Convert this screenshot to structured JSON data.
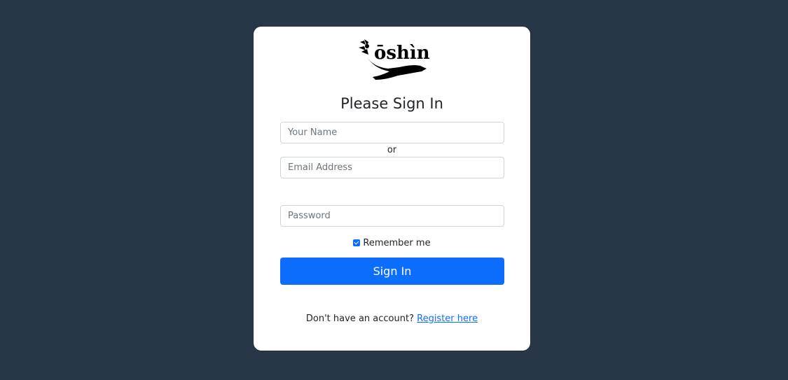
{
  "login": {
    "title": "Please Sign In",
    "name_placeholder": "Your Name",
    "or_text": "or",
    "email_placeholder": "Email Address",
    "password_placeholder": "Password",
    "remember_label": "Remember me",
    "remember_checked": true,
    "signin_label": "Sign In",
    "no_account_text": "Don't have an account?",
    "register_label": "Register here"
  },
  "colors": {
    "background": "#283747",
    "primary": "#0d6efd"
  }
}
